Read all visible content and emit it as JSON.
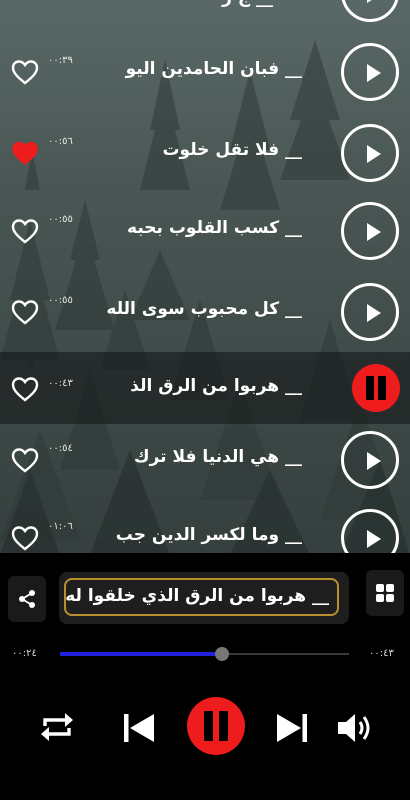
{
  "tracks": [
    {
      "title": "__ فبان الحامدين اليو",
      "duration": "٠٠:٣٩",
      "favorite": false,
      "state": "play"
    },
    {
      "title": "__ فلا تقل خلوت",
      "duration": "٠٠:٥٦",
      "favorite": true,
      "state": "play"
    },
    {
      "title": "__ كسب القلوب بحبه",
      "duration": "٠٠:٥٥",
      "favorite": false,
      "state": "play"
    },
    {
      "title": "__ كل محبوب سوى الله",
      "duration": "٠٠:٥٥",
      "favorite": false,
      "state": "play"
    },
    {
      "title": "__ هربوا من الرق الذ",
      "duration": "٠٠:٤٣",
      "favorite": false,
      "state": "playing"
    },
    {
      "title": "__ هي الدنيا فلا ترك",
      "duration": "٠٠:٥٤",
      "favorite": false,
      "state": "play"
    },
    {
      "title": "__ وما لكسر الدين جب",
      "duration": "٠١:٠٦",
      "favorite": false,
      "state": "play"
    }
  ],
  "player": {
    "now_playing": "__ هربوا من الرق الذي خلقوا له",
    "elapsed": "٠٠:٢٤",
    "total": "٠٠:٤٣",
    "progress": 0.56
  },
  "icons": {
    "share": "share-icon",
    "grid": "grid-icon",
    "repeat": "repeat-icon",
    "previous": "skip-previous-icon",
    "pause": "pause-icon",
    "next": "skip-next-icon",
    "volume": "volume-icon"
  },
  "colors": {
    "accent_red": "#ee1c1c",
    "progress_blue": "#2222dd",
    "highlight_gold": "#b8912e"
  }
}
